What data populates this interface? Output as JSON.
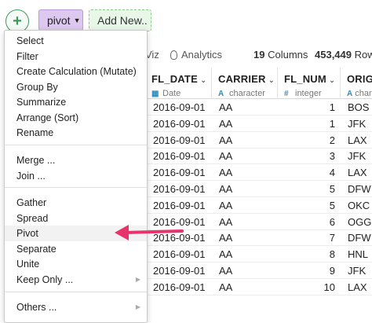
{
  "toolbar": {
    "add_icon": "plus-icon",
    "pivot_label": "pivot",
    "add_new_label": "Add New.."
  },
  "info": {
    "viz_label": "Viz",
    "analytics_label": "Analytics",
    "columns_count": "19",
    "columns_label": "Columns",
    "rows_count": "453,449",
    "rows_label": "Rows"
  },
  "table": {
    "columns": [
      {
        "name": "FL_DATE",
        "type": "Date",
        "type_icon": "calendar-icon"
      },
      {
        "name": "CARRIER",
        "type": "character",
        "type_icon": "character-icon"
      },
      {
        "name": "FL_NUM",
        "type": "integer",
        "type_icon": "hash-icon"
      },
      {
        "name": "ORIGI",
        "type": "chara",
        "type_icon": "character-icon"
      }
    ],
    "rows": [
      [
        "2016-09-01",
        "AA",
        "1",
        "BOS"
      ],
      [
        "2016-09-01",
        "AA",
        "1",
        "JFK"
      ],
      [
        "2016-09-01",
        "AA",
        "2",
        "LAX"
      ],
      [
        "2016-09-01",
        "AA",
        "3",
        "JFK"
      ],
      [
        "2016-09-01",
        "AA",
        "4",
        "LAX"
      ],
      [
        "2016-09-01",
        "AA",
        "5",
        "DFW"
      ],
      [
        "2016-09-01",
        "AA",
        "5",
        "OKC"
      ],
      [
        "2016-09-01",
        "AA",
        "6",
        "OGG"
      ],
      [
        "2016-09-01",
        "AA",
        "7",
        "DFW"
      ],
      [
        "2016-09-01",
        "AA",
        "8",
        "HNL"
      ],
      [
        "2016-09-01",
        "AA",
        "9",
        "JFK"
      ],
      [
        "2016-09-01",
        "AA",
        "10",
        "LAX"
      ]
    ]
  },
  "menu": {
    "items": [
      {
        "label": "Select"
      },
      {
        "label": "Filter"
      },
      {
        "label": "Create Calculation (Mutate)"
      },
      {
        "label": "Group By"
      },
      {
        "label": "Summarize"
      },
      {
        "label": "Arrange (Sort)"
      },
      {
        "label": "Rename"
      },
      {
        "label": "Merge ..."
      },
      {
        "label": "Join ..."
      },
      {
        "label": "Gather"
      },
      {
        "label": "Spread"
      },
      {
        "label": "Pivot"
      },
      {
        "label": "Separate"
      },
      {
        "label": "Unite"
      },
      {
        "label": "Keep Only ...",
        "submenu": true
      },
      {
        "label": "Others ...",
        "submenu": true
      }
    ],
    "highlighted": "Pivot"
  },
  "colors": {
    "arrow": "#e8336d",
    "pivot_chip": "#ddc8ef",
    "add_new_chip": "#e8f7e7",
    "add_circle": "#3a9a5b"
  }
}
